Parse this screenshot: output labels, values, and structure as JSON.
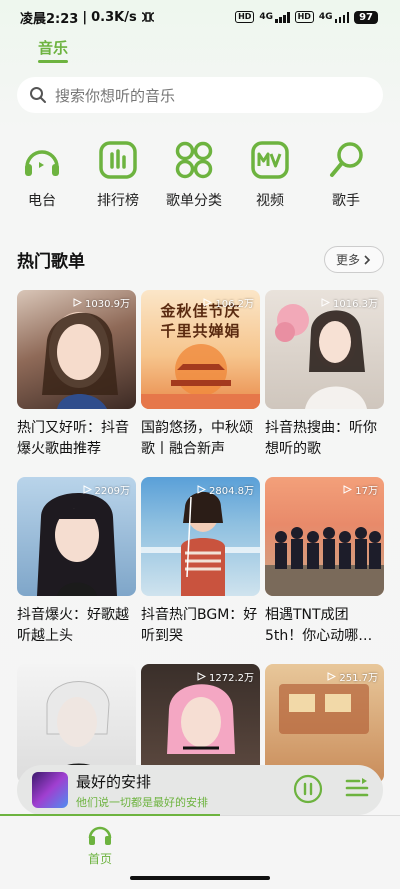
{
  "status_bar": {
    "time": "凌晨2:23",
    "network_speed": "0.3K/s",
    "hd1": "HD",
    "hd2": "HD",
    "net1": "4G",
    "net2": "4G",
    "battery": "97"
  },
  "top_tab": {
    "label": "音乐"
  },
  "search": {
    "placeholder": "搜索你想听的音乐"
  },
  "categories": [
    {
      "label": "电台",
      "icon": "radio-icon"
    },
    {
      "label": "排行榜",
      "icon": "ranking-icon"
    },
    {
      "label": "歌单分类",
      "icon": "grid-icon"
    },
    {
      "label": "视频",
      "icon": "mv-icon"
    },
    {
      "label": "歌手",
      "icon": "singer-icon"
    }
  ],
  "section": {
    "title": "热门歌单",
    "more_label": "更多"
  },
  "playlists": [
    {
      "title": "热门又好听：抖音爆火歌曲推荐",
      "play_count": "1030.9万"
    },
    {
      "title": "国韵悠扬，中秋颂歌丨融合新声",
      "play_count": "106.2万",
      "cover_text_1": "金秋佳节庆",
      "cover_text_2": "千里共婵娟"
    },
    {
      "title": "抖音热搜曲：听你想听的歌",
      "play_count": "1016.3万"
    },
    {
      "title": "抖音爆火：好歌越听越上头",
      "play_count": "2209万"
    },
    {
      "title": "抖音热门BGM：好听到哭",
      "play_count": "2804.8万"
    },
    {
      "title": "相遇TNT成团5th！你心动哪…",
      "play_count": "17万"
    },
    {
      "title": "",
      "play_count": ""
    },
    {
      "title": "",
      "play_count": "1272.2万"
    },
    {
      "title": "",
      "play_count": "251.7万"
    }
  ],
  "player": {
    "song": "最好的安排",
    "lyric": "他们说一切都是最好的安排"
  },
  "bottom_nav": {
    "home_label": "首页"
  },
  "colors": {
    "accent": "#6db33f"
  }
}
